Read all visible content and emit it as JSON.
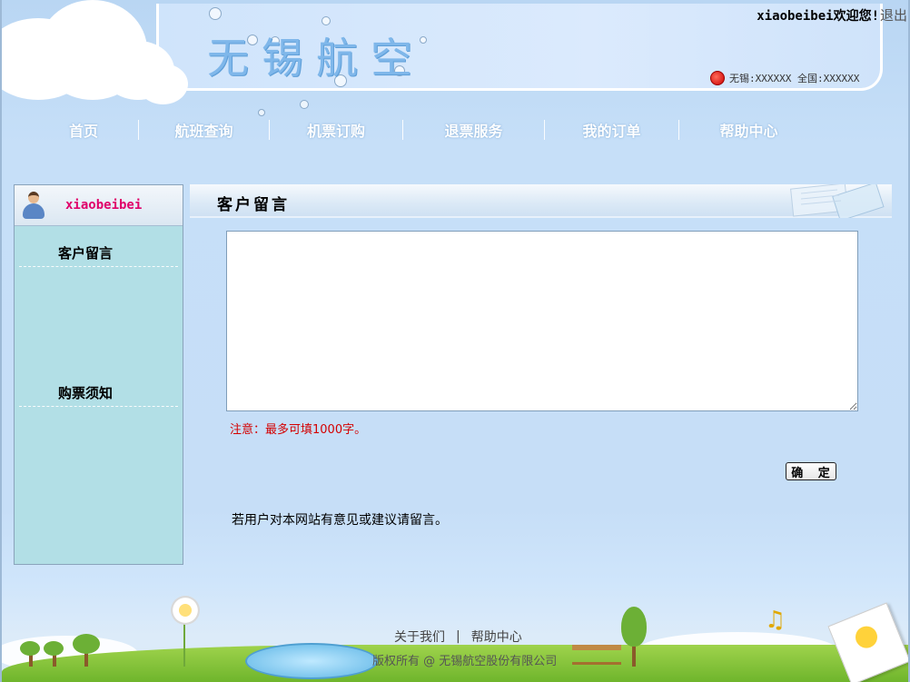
{
  "header": {
    "site_title": "无锡航空",
    "welcome": "xiaobeibei欢迎您!",
    "logout": "退出",
    "phone_text": "无锡:XXXXXX 全国:XXXXXX"
  },
  "nav": {
    "items": [
      "首页",
      "航班查询",
      "机票订购",
      "退票服务",
      "我的订单",
      "帮助中心"
    ]
  },
  "sidebar": {
    "username": "xiaobeibei",
    "links": [
      "客户留言",
      "购票须知"
    ]
  },
  "main": {
    "title": "客户留言",
    "textarea_value": "",
    "notice": "注意：最多可填1000字。",
    "confirm_label": "确 定",
    "hint": "若用户对本网站有意见或建议请留言。"
  },
  "footer": {
    "links": [
      "关于我们",
      "帮助中心"
    ],
    "copyright": "版权所有 @ 无锡航空股份有限公司"
  },
  "colors": {
    "username": "#e0006a",
    "notice": "#d40000",
    "sidebar_bg": "#b2dfe6",
    "page_bg": "#c6def7"
  }
}
